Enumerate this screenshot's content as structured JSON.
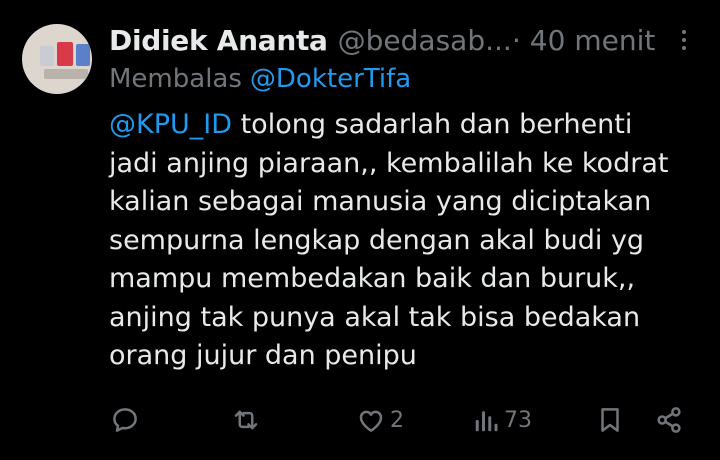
{
  "tweet": {
    "author_name": "Didiek Ananta",
    "author_handle": "@bedasab...",
    "time": "· 40 menit",
    "reply_prefix": "Membalas",
    "reply_to": "@DokterTifa",
    "body_mention": "@KPU_ID",
    "body_lines": [
      " tolong sadarlah dan berhenti",
      "jadi anjing piaraan,, kembalilah ke kodrat",
      "kalian sebagai manusia yang diciptakan",
      "sempurna lengkap dengan akal budi yg",
      "mampu membedakan baik dan buruk,,",
      "anjing tak punya akal tak bisa bedakan",
      "orang jujur dan penipu"
    ]
  },
  "actions": {
    "reply_icon": "reply-icon",
    "retweet_icon": "retweet-icon",
    "like_icon": "heart-icon",
    "like_count": "2",
    "views_icon": "views-icon",
    "views_count": "73",
    "bookmark_icon": "bookmark-icon",
    "share_icon": "share-icon"
  },
  "colors": {
    "background": "#000000",
    "text": "#e7e9ea",
    "muted": "#71767b",
    "link": "#1d9bf0"
  }
}
